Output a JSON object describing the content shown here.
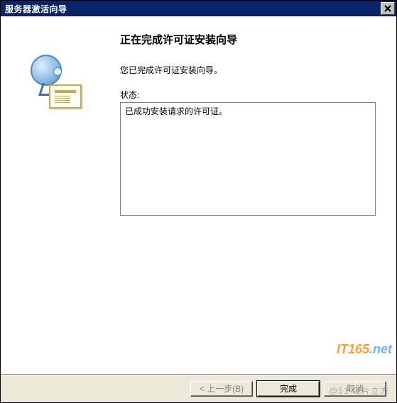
{
  "window": {
    "title": "服务器激活向导"
  },
  "wizard": {
    "heading": "正在完成许可证安装向导",
    "subtext": "您已完成许可证安装向导。",
    "status_label": "状态:",
    "status_text": "已成功安装请求的许可证。"
  },
  "buttons": {
    "back": "< 上一步(B)",
    "finish": "完成",
    "cancel": "取消"
  },
  "watermark": {
    "brand_left": "IT165",
    "brand_right": ".net",
    "faint": "@51 现片立方"
  }
}
